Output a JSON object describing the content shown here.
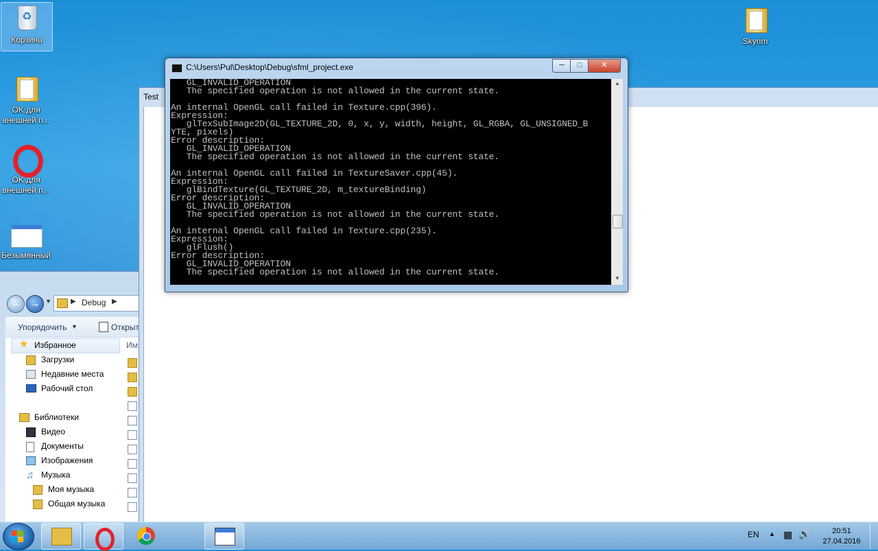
{
  "desktop": {
    "icons": [
      {
        "label": "Корзина"
      },
      {
        "label": "OK для внешней п..."
      },
      {
        "label": "OK для внешней п..."
      },
      {
        "label": "Безымянный"
      },
      {
        "label": "Skyrim"
      }
    ]
  },
  "test_window": {
    "title": "Test"
  },
  "explorer": {
    "address_segment": "Debug",
    "toolbar": {
      "organize": "Упорядочить",
      "open": "Открыть"
    },
    "file_column_header": "Имя",
    "nav": {
      "favorites": "Избранное",
      "downloads": "Загрузки",
      "recent": "Недавние места",
      "desktop": "Рабочий стол",
      "libraries": "Библиотеки",
      "video": "Видео",
      "documents": "Документы",
      "pictures": "Изображения",
      "music": "Музыка",
      "my_music": "Моя музыка",
      "public_music": "Общая музыка"
    }
  },
  "console": {
    "title": "C:\\Users\\Pul\\Desktop\\Debug\\sfml_project.exe",
    "lines": [
      "   GL_INVALID_OPERATION",
      "   The specified operation is not allowed in the current state.",
      "",
      "An internal OpenGL call failed in Texture.cpp(396).",
      "Expression:",
      "   glTexSubImage2D(GL_TEXTURE_2D, 0, x, y, width, height, GL_RGBA, GL_UNSIGNED_B",
      "YTE, pixels)",
      "Error description:",
      "   GL_INVALID_OPERATION",
      "   The specified operation is not allowed in the current state.",
      "",
      "An internal OpenGL call failed in TextureSaver.cpp(45).",
      "Expression:",
      "   glBindTexture(GL_TEXTURE_2D, m_textureBinding)",
      "Error description:",
      "   GL_INVALID_OPERATION",
      "   The specified operation is not allowed in the current state.",
      "",
      "An internal OpenGL call failed in Texture.cpp(235).",
      "Expression:",
      "   glFlush()",
      "Error description:",
      "   GL_INVALID_OPERATION",
      "   The specified operation is not allowed in the current state."
    ]
  },
  "taskbar": {
    "language": "EN",
    "time": "20:51",
    "date": "27.04.2016",
    "pinned": [
      "explorer-icon",
      "opera-icon",
      "chrome-icon",
      "app-window-icon"
    ]
  }
}
